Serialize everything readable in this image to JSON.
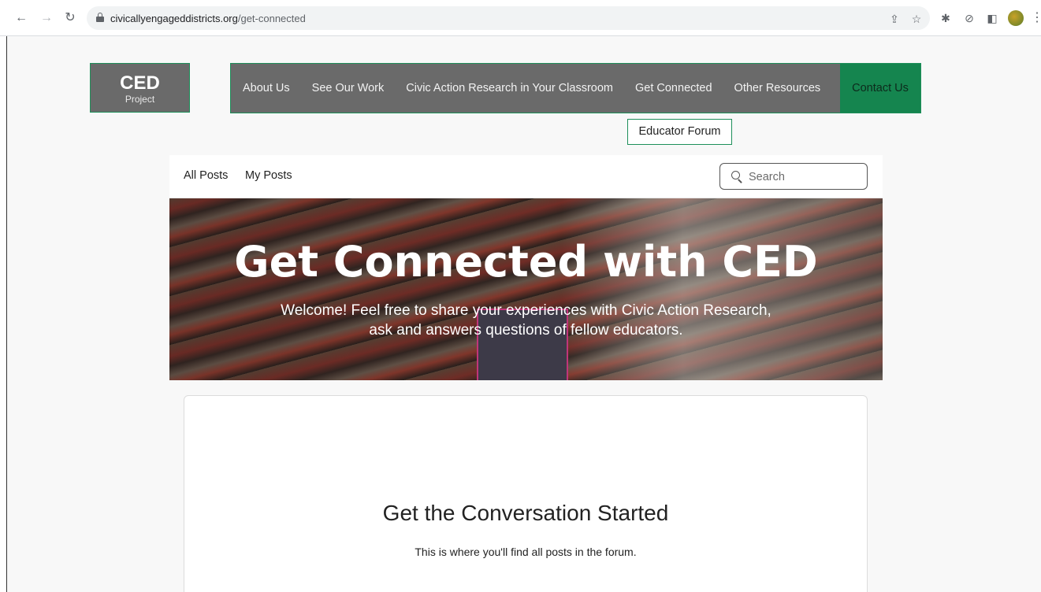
{
  "browser": {
    "url_domain": "civicallyengageddistricts.org",
    "url_path": "/get-connected"
  },
  "site": {
    "logo_main": "CED",
    "logo_sub": "Project",
    "nav": [
      {
        "label": "About Us"
      },
      {
        "label": "See Our Work"
      },
      {
        "label": "Civic Action Research in Your Classroom"
      },
      {
        "label": "Get Connected"
      },
      {
        "label": "Other Resources"
      }
    ],
    "contact_label": "Contact Us",
    "submenu_label": "Educator Forum",
    "accent_color": "#15854f"
  },
  "forum": {
    "tabs": [
      {
        "label": "All Posts"
      },
      {
        "label": "My Posts"
      }
    ],
    "search_placeholder": "Search"
  },
  "hero": {
    "title": "Get Connected with CED",
    "subtitle": "Welcome! Feel free to share your experiences with Civic Action Research, ask and answers questions of fellow educators."
  },
  "empty_state": {
    "title": "Get the Conversation Started",
    "text": "This is where you'll find all posts in the forum."
  }
}
